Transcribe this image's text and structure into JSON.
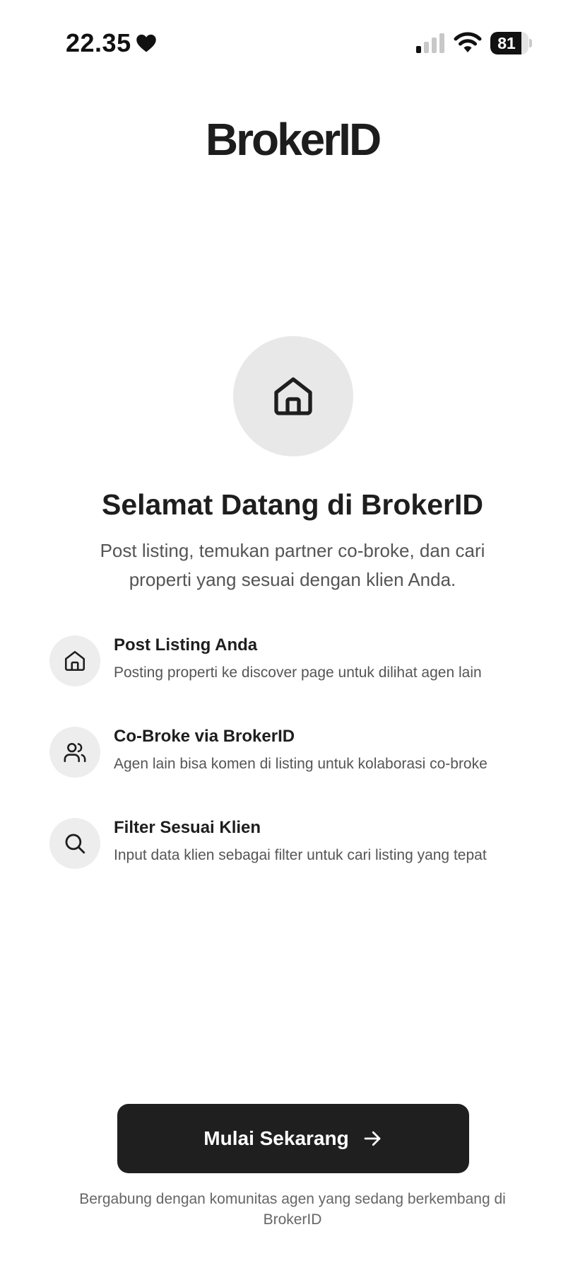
{
  "status_bar": {
    "time": "22.35",
    "battery_level": "81",
    "battery_fraction": 0.81
  },
  "app": {
    "logo_text": "BrokerID"
  },
  "welcome": {
    "title": "Selamat Datang di BrokerID",
    "subtitle": "Post listing, temukan partner co-broke, dan cari properti yang sesuai dengan klien Anda."
  },
  "features": [
    {
      "icon": "home-icon",
      "title": "Post Listing Anda",
      "description": "Posting properti ke discover page untuk dilihat agen lain"
    },
    {
      "icon": "users-icon",
      "title": "Co-Broke via BrokerID",
      "description": "Agen lain bisa komen di listing untuk kolaborasi co-broke"
    },
    {
      "icon": "search-icon",
      "title": "Filter Sesuai Klien",
      "description": "Input data klien sebagai filter untuk cari listing yang tepat"
    }
  ],
  "cta": {
    "label": "Mulai Sekarang",
    "icon": "arrow-right-icon"
  },
  "footer": {
    "note": "Bergabung dengan komunitas agen yang sedang berkembang di BrokerID"
  },
  "colors": {
    "primary_button": "#1f1f1f",
    "icon_circle": "#ededed",
    "hero_circle": "#e8e8e8",
    "muted_text": "#555555"
  }
}
